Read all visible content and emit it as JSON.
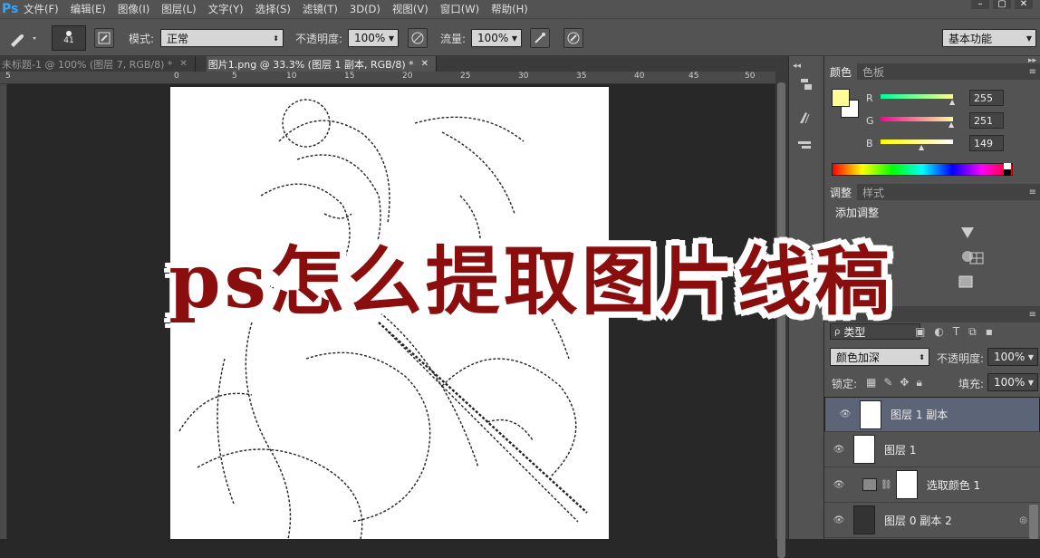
{
  "app": {
    "logo": "Ps"
  },
  "menu": [
    "文件(F)",
    "编辑(E)",
    "图像(I)",
    "图层(L)",
    "文字(Y)",
    "选择(S)",
    "滤镜(T)",
    "3D(D)",
    "视图(V)",
    "窗口(W)",
    "帮助(H)"
  ],
  "window_buttons": [
    "–",
    "▢",
    "✕"
  ],
  "options": {
    "brush_size": "41",
    "mode_label": "模式:",
    "mode_value": "正常",
    "opacity_label": "不透明度:",
    "opacity_value": "100%",
    "flow_label": "流量:",
    "flow_value": "100%",
    "workspace": "基本功能"
  },
  "tabs": [
    {
      "label": "未标题-1 @ 100% (图层 7, RGB/8) *",
      "close": "✕"
    },
    {
      "label": "图片1.png @ 33.3% (图层 1 副本, RGB/8) *",
      "close": "✕"
    }
  ],
  "ruler_labels": [
    "5",
    "0",
    "5",
    "10",
    "15",
    "20",
    "25",
    "30",
    "35",
    "40",
    "45",
    "50"
  ],
  "color_panel": {
    "tabs": [
      "颜色",
      "色板"
    ],
    "r_label": "R",
    "g_label": "G",
    "b_label": "B",
    "r": "255",
    "g": "251",
    "b": "149",
    "fg_color": "#fffb95"
  },
  "adjust_panel": {
    "tabs": [
      "调整",
      "样式"
    ],
    "title": "添加调整"
  },
  "layers_panel": {
    "filter_label": "类型",
    "blend_mode": "颜色加深",
    "opacity_label": "不透明度:",
    "opacity_value": "100%",
    "lock_label": "锁定:",
    "fill_label": "填充:",
    "fill_value": "100%",
    "layers": [
      {
        "name": "图层 1 副本"
      },
      {
        "name": "图层 1"
      },
      {
        "name": "选取颜色 1"
      },
      {
        "name": "图层 0 副本 2"
      }
    ]
  },
  "overlay_title": "ps怎么提取图片线稿"
}
